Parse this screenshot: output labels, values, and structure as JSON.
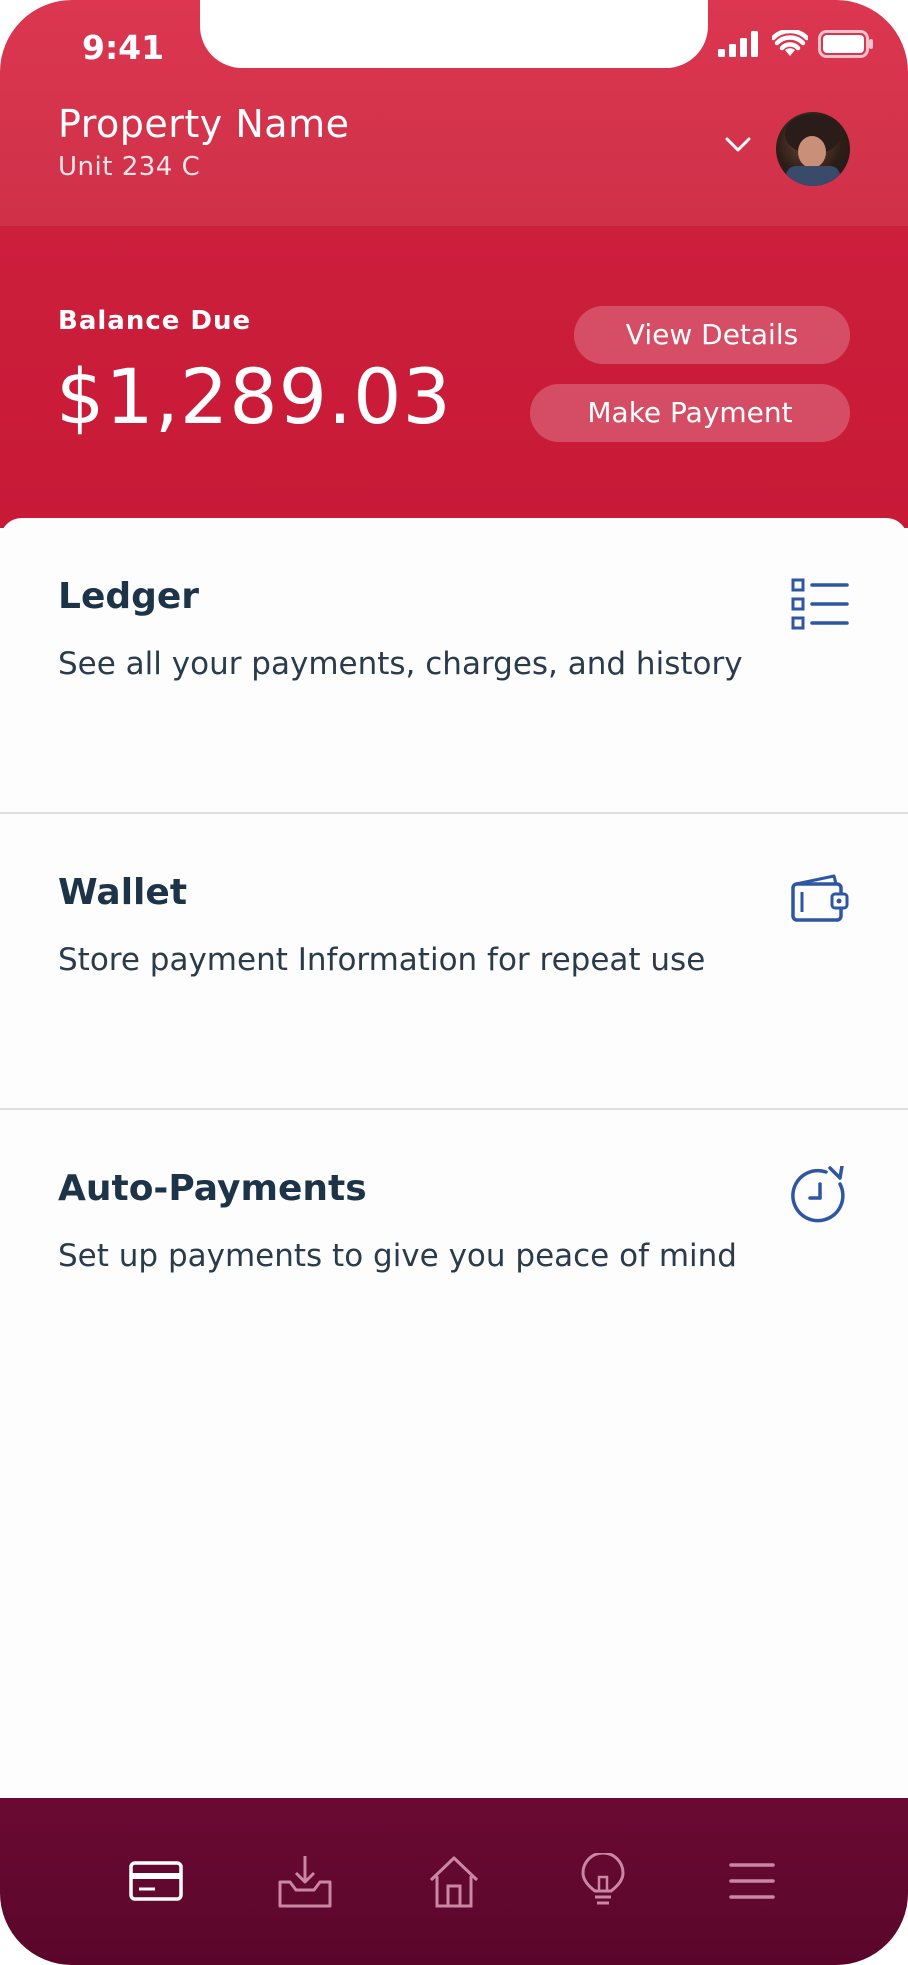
{
  "status_bar": {
    "time": "9:41"
  },
  "header": {
    "property_name": "Property Name",
    "unit": "Unit 234 C"
  },
  "balance": {
    "label": "Balance Due",
    "amount": "$1,289.03",
    "view_details_label": "View Details",
    "make_payment_label": "Make Payment"
  },
  "cards": [
    {
      "title": "Ledger",
      "description": "See all your payments, charges, and history",
      "icon": "list-icon"
    },
    {
      "title": "Wallet",
      "description": "Store payment Information for repeat use",
      "icon": "wallet-icon"
    },
    {
      "title": "Auto-Payments",
      "description": "Set up payments to give you peace of mind",
      "icon": "clock-refresh-icon"
    }
  ],
  "bottom_nav": {
    "items": [
      {
        "icon": "credit-card-icon",
        "active": true
      },
      {
        "icon": "inbox-download-icon",
        "active": false
      },
      {
        "icon": "home-icon",
        "active": false
      },
      {
        "icon": "lightbulb-icon",
        "active": false
      },
      {
        "icon": "menu-icon",
        "active": false
      }
    ]
  },
  "colors": {
    "header": "#dc3650",
    "balance_bg": "#c81a37",
    "card_title": "#1d3448",
    "icon_blue": "#2f56a2",
    "nav_bg": "#6a0a33"
  }
}
